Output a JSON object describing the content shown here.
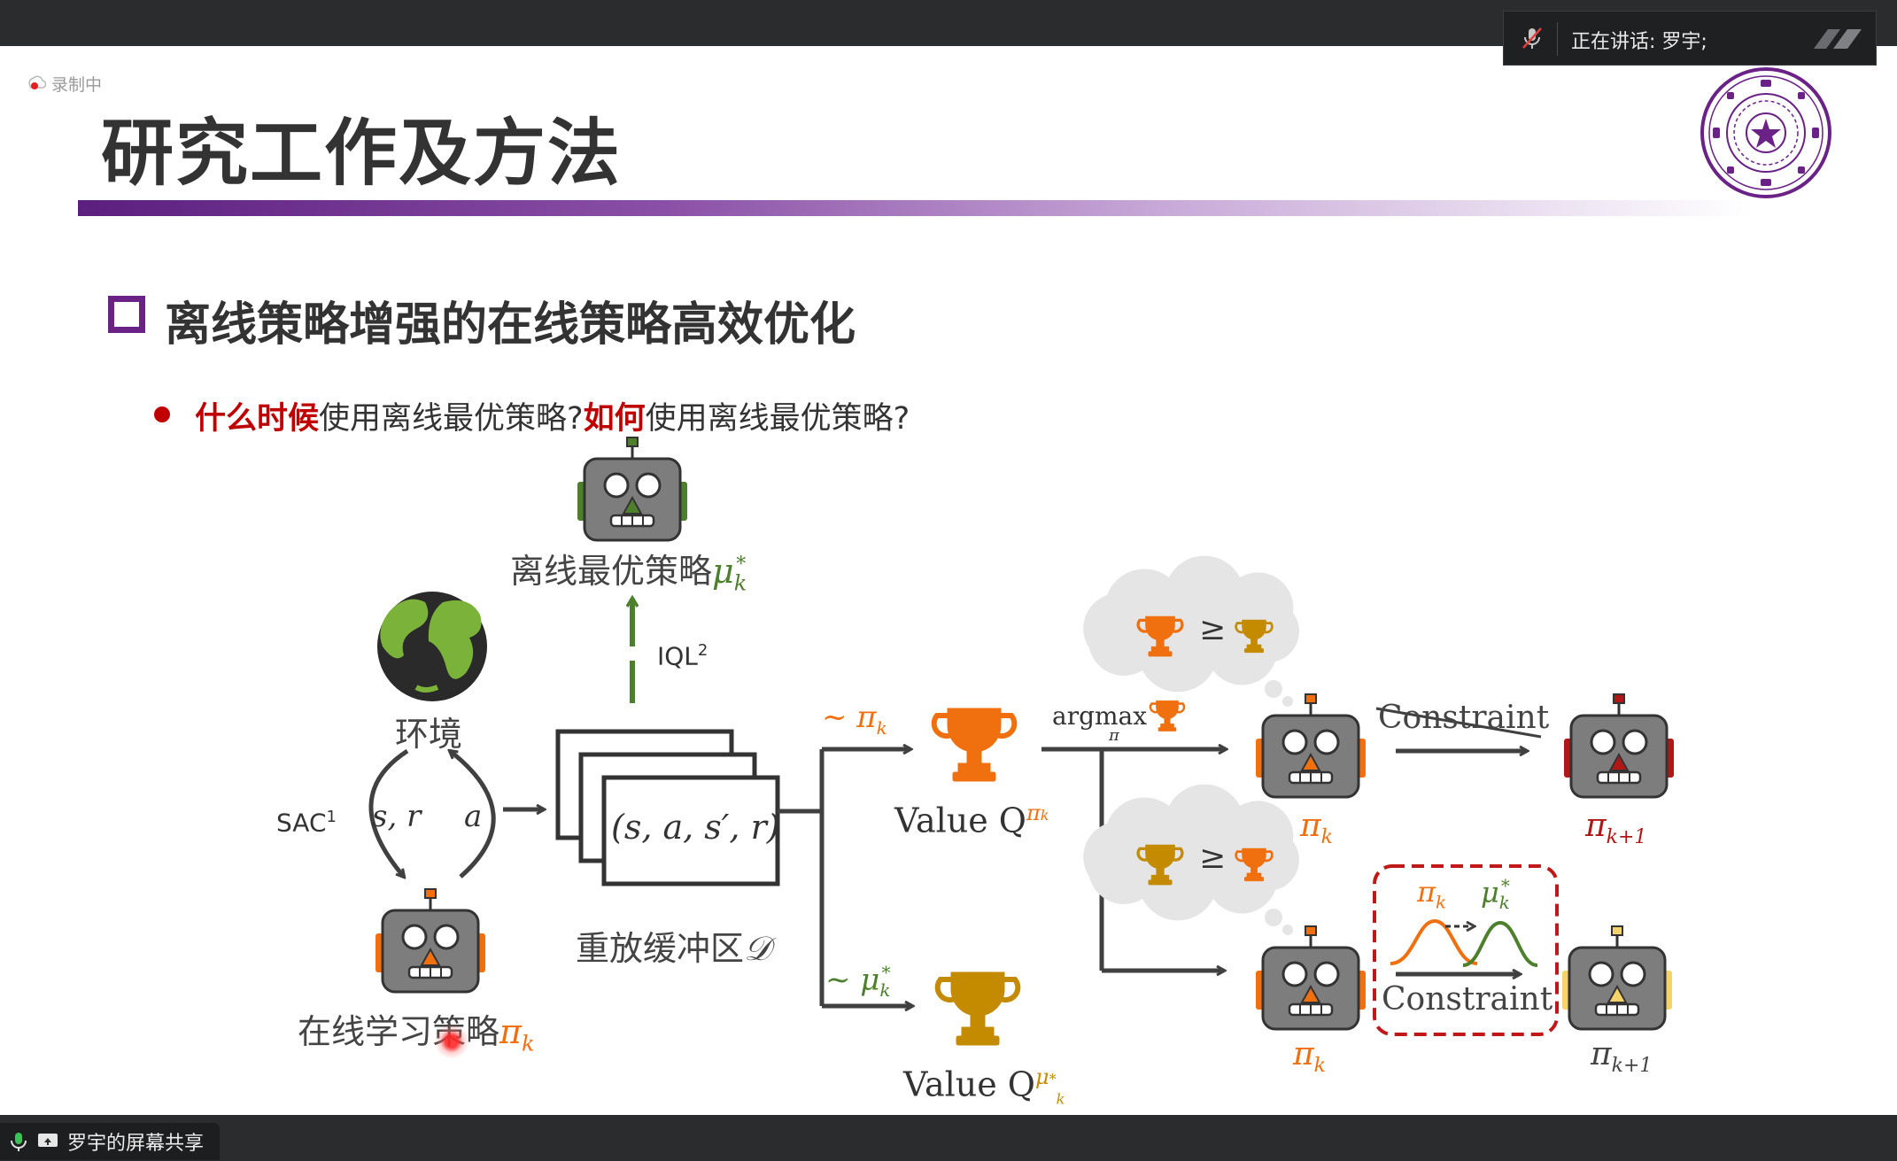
{
  "meeting": {
    "speaking_label": "正在讲话:  罗宇;",
    "recording_label": "录制中",
    "share_label": "罗宇的屏幕共享",
    "mic_icon": "mic-muted-icon"
  },
  "slide": {
    "title": "研究工作及方法",
    "section_title": "离线策略增强的在线策略高效优化",
    "bullet": {
      "part1_red": "什么时候",
      "part2": "使用离线最优策略?",
      "part3_red": "如何",
      "part4": "使用离线最优策略?"
    },
    "colors": {
      "purple": "#6a2287",
      "red": "#c00000",
      "orange": "#f07010",
      "gold": "#c48a00",
      "green": "#4d7f2d",
      "crimson": "#b01818",
      "dashed_box": "#c01818"
    }
  },
  "diagram": {
    "offline_policy_label": "离线最优策略",
    "offline_policy_symbol": "μ",
    "offline_policy_sub": "k",
    "offline_policy_sup": "*",
    "iql_label": "IQL",
    "iql_sup": "2",
    "env_label": "环境",
    "sac_label": "SAC",
    "sac_sup": "1",
    "s_r_label": "s, r",
    "a_label": "a",
    "replay_tuple": "(s, a, s′, r)",
    "replay_label": "重放缓冲区",
    "replay_symbol": "𝒟",
    "online_policy_label": "在线学习策略",
    "online_policy_symbol": "π",
    "online_policy_sub": "k",
    "sample_pi": "~ π",
    "sample_pi_sub": "k",
    "sample_mu": "~ μ",
    "sample_mu_sub": "k",
    "sample_mu_sup": "*",
    "value_q_pi": "Value Q",
    "value_q_pi_sup": "π",
    "value_q_pi_sup_sub": "k",
    "value_q_mu": "Value Q",
    "value_q_mu_sup": "μ",
    "value_q_mu_sup_sub": "k",
    "value_q_mu_sup_star": "*",
    "argmax_label": "argmax",
    "argmax_sub": "π",
    "geq": "≥",
    "constraint_struck": "Constraint",
    "constraint_label": "Constraint",
    "pi_k_top": "π",
    "pi_k_top_sub": "k",
    "pi_k1_top": "π",
    "pi_k1_top_sub": "k+1",
    "pi_k_bottom": "π",
    "pi_k_bottom_sub": "k",
    "pi_k1_bottom": "π",
    "pi_k1_bottom_sub": "k+1",
    "box_pi": "π",
    "box_pi_sub": "k",
    "box_mu": "μ",
    "box_mu_sub": "k",
    "box_mu_sup": "*"
  }
}
